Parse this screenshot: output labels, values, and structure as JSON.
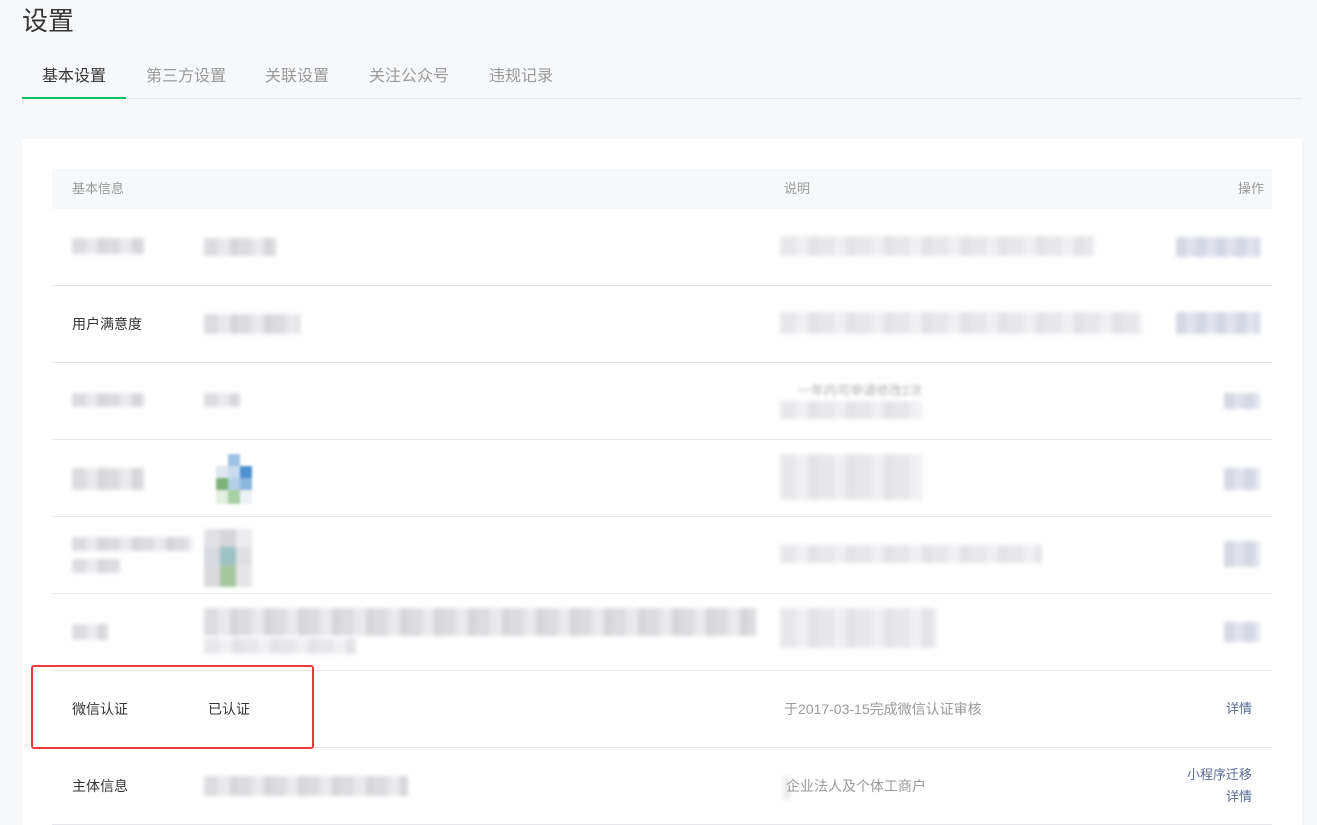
{
  "page": {
    "title": "设置"
  },
  "tabs": [
    {
      "label": "基本设置",
      "active": true
    },
    {
      "label": "第三方设置",
      "active": false
    },
    {
      "label": "关联设置",
      "active": false
    },
    {
      "label": "关注公众号",
      "active": false
    },
    {
      "label": "违规记录",
      "active": false
    }
  ],
  "table": {
    "headers": {
      "basic_info": "基本信息",
      "description": "说明",
      "actions": "操作"
    },
    "rows": [
      {
        "label": "",
        "value": "",
        "description": "",
        "actions": []
      },
      {
        "label": "用户满意度",
        "value": "",
        "description": "",
        "actions": []
      },
      {
        "label": "",
        "value": "",
        "description": "一年内可申请修改2次",
        "actions": []
      },
      {
        "label": "",
        "value": "",
        "description": "",
        "actions": []
      },
      {
        "label": "",
        "value": "",
        "description": "",
        "actions": []
      },
      {
        "label": "",
        "value": "",
        "description": "",
        "actions": []
      },
      {
        "label": "微信认证",
        "value": "已认证",
        "description": "于2017-03-15完成微信认证审核",
        "actions": [
          "详情"
        ]
      },
      {
        "label": "主体信息",
        "value": "",
        "description": "企业法人及个体工商户",
        "actions": [
          "小程序迁移",
          "详情"
        ]
      }
    ]
  },
  "colors": {
    "accent": "#07c160",
    "link": "#576b95",
    "highlight": "#f2373b"
  }
}
